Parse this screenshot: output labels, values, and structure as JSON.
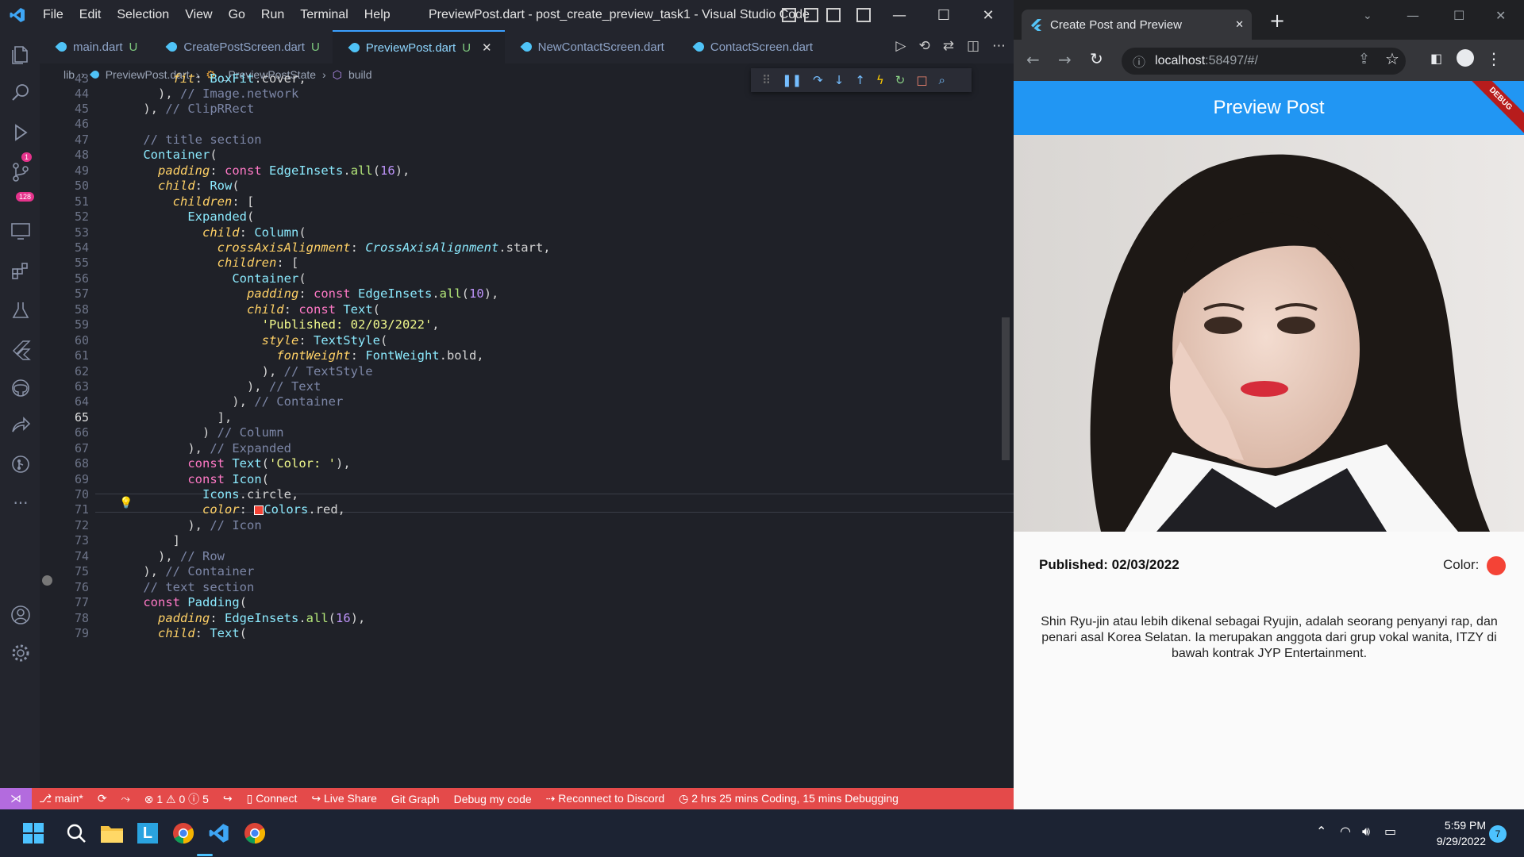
{
  "vscode": {
    "menu": [
      "File",
      "Edit",
      "Selection",
      "View",
      "Go",
      "Run",
      "Terminal",
      "Help"
    ],
    "title": "PreviewPost.dart - post_create_preview_task1 - Visual Studio Code",
    "badges": {
      "debug": "1",
      "scm": "128"
    },
    "tabs": [
      {
        "label": "main.dart",
        "mod": "U"
      },
      {
        "label": "CreatePostScreen.dart",
        "mod": "U"
      },
      {
        "label": "PreviewPost.dart",
        "mod": "U",
        "close": "✕"
      },
      {
        "label": "NewContactScreen.dart",
        "mod": ""
      },
      {
        "label": "ContactScreen.dart",
        "mod": ""
      }
    ],
    "breadcrumb": [
      "lib",
      "PreviewPost.dart",
      "_PreviewPostState",
      "build"
    ],
    "line_numbers": [
      "43",
      "44",
      "45",
      "46",
      "47",
      "48",
      "49",
      "50",
      "51",
      "52",
      "53",
      "54",
      "55",
      "56",
      "57",
      "58",
      "59",
      "60",
      "61",
      "62",
      "63",
      "64",
      "65",
      "66",
      "67",
      "68",
      "69",
      "70",
      "71",
      "72",
      "73",
      "74",
      "75",
      "76",
      "77",
      "78",
      "79"
    ],
    "statusbar": {
      "branch": "main*",
      "problems": "⊗ 1 ⚠ 0 ⓘ 5",
      "connect": "Connect",
      "live_share": "Live Share",
      "git_graph": "Git Graph",
      "debug_code": "Debug my code",
      "discord": "Reconnect to Discord",
      "time": "2 hrs 25 mins Coding, 15 mins Debugging"
    }
  },
  "chrome": {
    "tab_title": "Create Post and Preview",
    "tab_close": "✕",
    "new_tab": "+",
    "url_host": "localhost",
    "url_path": ":58497/#/",
    "app": {
      "appbar_title": "Preview Post",
      "debug_banner": "DEBUG",
      "published": "Published: 02/03/2022",
      "color_label": "Color:",
      "description": "Shin Ryu-jin atau lebih dikenal sebagai Ryujin, adalah seorang penyanyi rap, dan penari asal Korea Selatan. Ia merupakan anggota dari grup vokal wanita, ITZY di bawah kontrak JYP Entertainment."
    }
  },
  "taskbar": {
    "time": "5:59 PM",
    "date": "9/29/2022",
    "notif": "7"
  },
  "colors": {
    "accent": "#2196f3",
    "status": "#e44a4a",
    "dot": "#f44336"
  }
}
